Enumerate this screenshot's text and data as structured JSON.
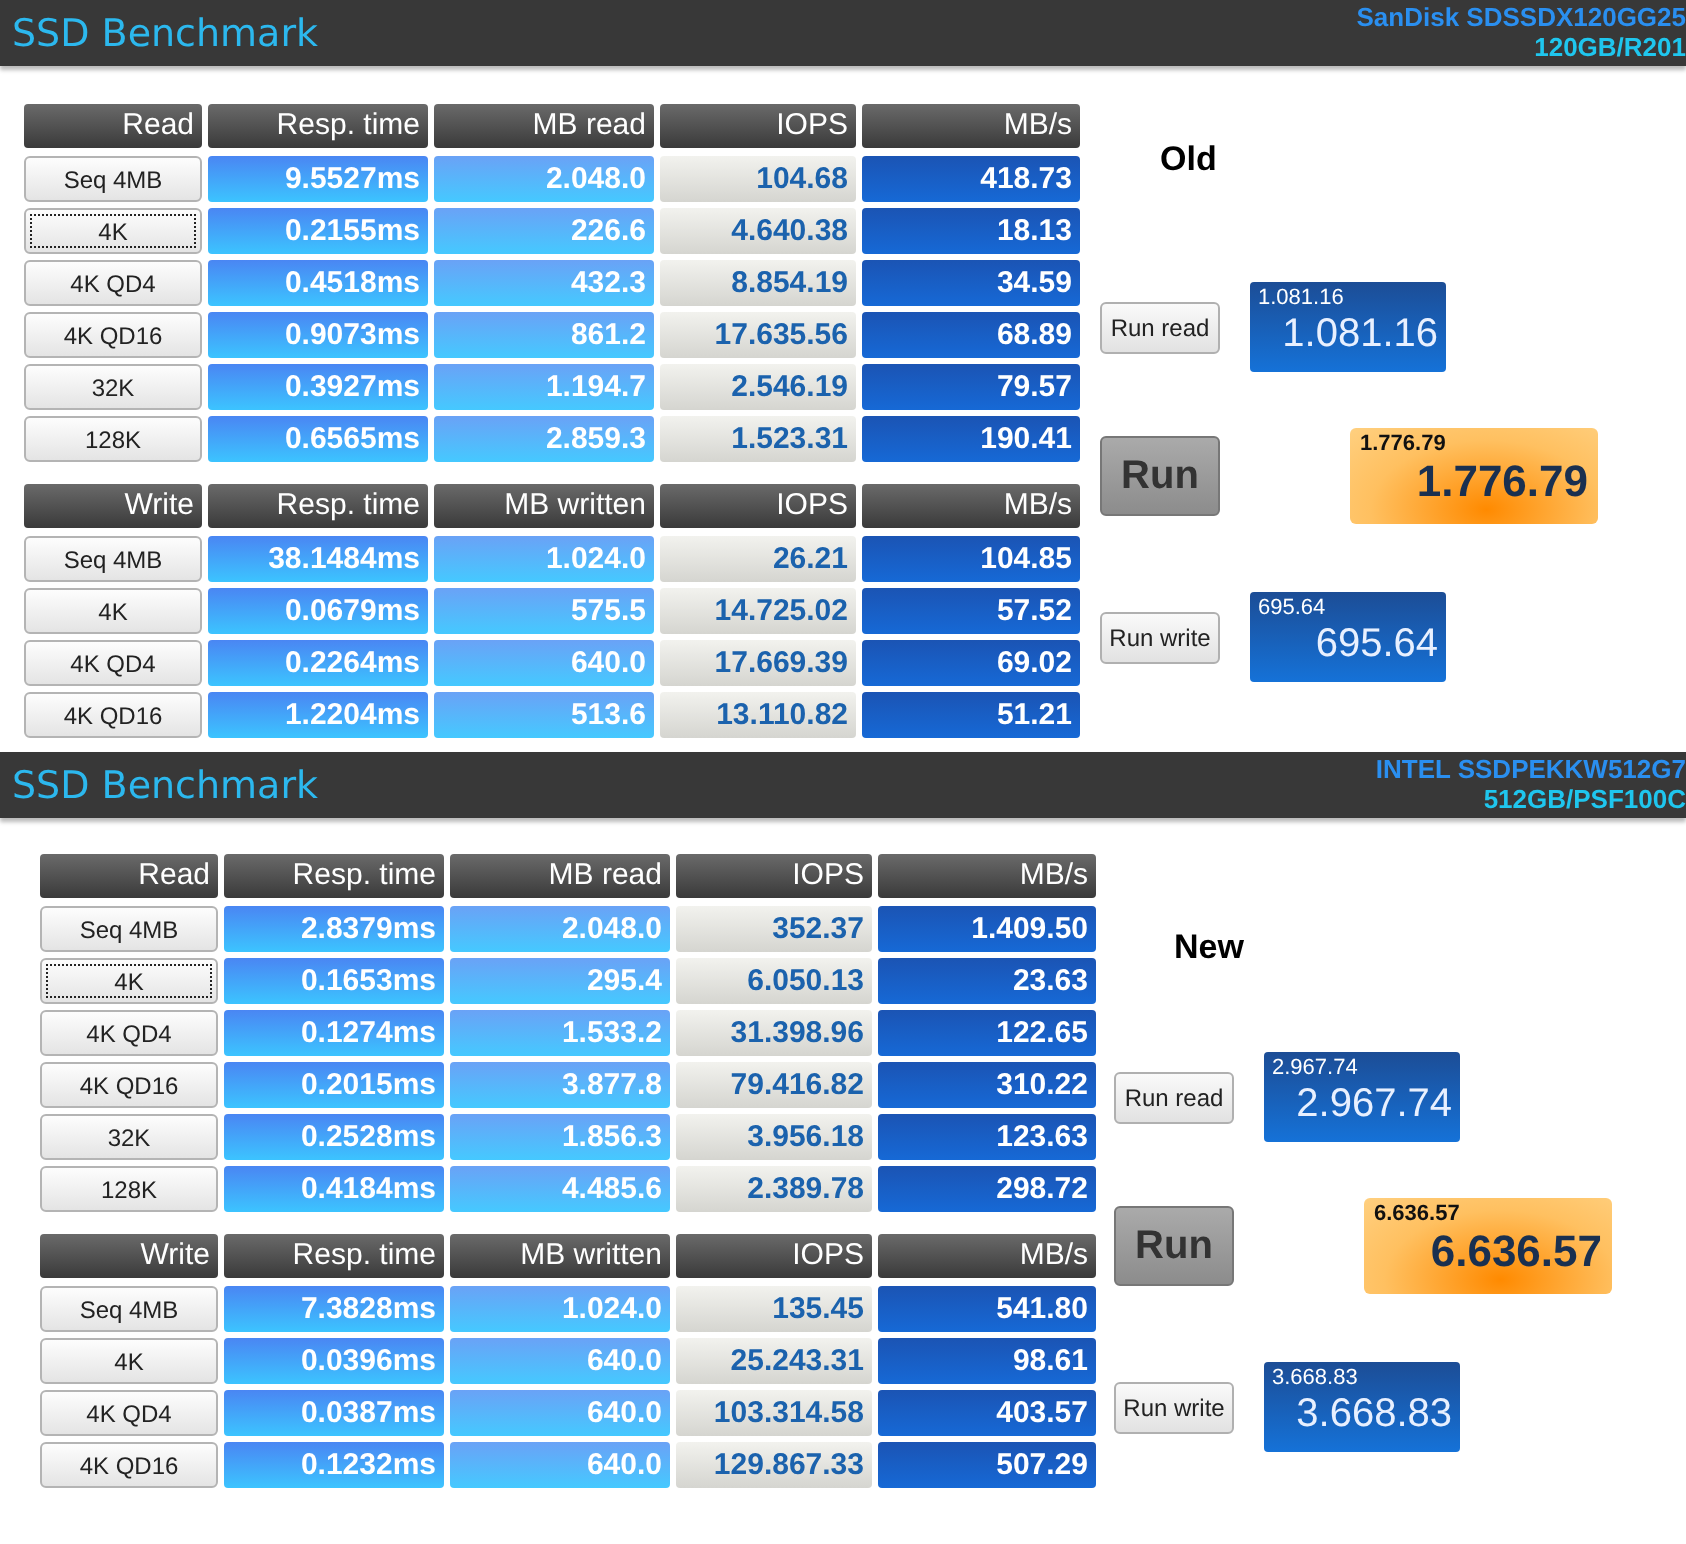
{
  "panels": [
    {
      "title": "SSD Benchmark",
      "drive_model": "SanDisk SDSSDX120GG25",
      "drive_info": "120GB/R201",
      "label": "Old",
      "tables": [
        {
          "columns": [
            "Read",
            "Resp. time",
            "MB read",
            "IOPS",
            "MB/s"
          ],
          "rows": [
            {
              "focused": false,
              "cells": [
                "Seq 4MB",
                "9.5527ms",
                "2.048.0",
                "104.68",
                "418.73"
              ]
            },
            {
              "focused": true,
              "cells": [
                "4K",
                "0.2155ms",
                "226.6",
                "4.640.38",
                "18.13"
              ]
            },
            {
              "focused": false,
              "cells": [
                "4K QD4",
                "0.4518ms",
                "432.3",
                "8.854.19",
                "34.59"
              ]
            },
            {
              "focused": false,
              "cells": [
                "4K QD16",
                "0.9073ms",
                "861.2",
                "17.635.56",
                "68.89"
              ]
            },
            {
              "focused": false,
              "cells": [
                "32K",
                "0.3927ms",
                "1.194.7",
                "2.546.19",
                "79.57"
              ]
            },
            {
              "focused": false,
              "cells": [
                "128K",
                "0.6565ms",
                "2.859.3",
                "1.523.31",
                "190.41"
              ]
            }
          ]
        },
        {
          "columns": [
            "Write",
            "Resp. time",
            "MB written",
            "IOPS",
            "MB/s"
          ],
          "rows": [
            {
              "focused": false,
              "cells": [
                "Seq 4MB",
                "38.1484ms",
                "1.024.0",
                "26.21",
                "104.85"
              ]
            },
            {
              "focused": false,
              "cells": [
                "4K",
                "0.0679ms",
                "575.5",
                "14.725.02",
                "57.52"
              ]
            },
            {
              "focused": false,
              "cells": [
                "4K QD4",
                "0.2264ms",
                "640.0",
                "17.669.39",
                "69.02"
              ]
            },
            {
              "focused": false,
              "cells": [
                "4K QD16",
                "1.2204ms",
                "513.6",
                "13.110.82",
                "51.21"
              ]
            }
          ]
        }
      ],
      "run_read": "Run read",
      "read_score": {
        "caption": "1.081.16",
        "value": "1.081.16"
      },
      "run": "Run",
      "total_score": {
        "caption": "1.776.79",
        "value": "1.776.79"
      },
      "run_write": "Run write",
      "write_score": {
        "caption": "695.64",
        "value": "695.64"
      }
    },
    {
      "title": "SSD Benchmark",
      "drive_model": "INTEL SSDPEKKW512G7",
      "drive_info": "512GB/PSF100C",
      "label": "New",
      "tables": [
        {
          "columns": [
            "Read",
            "Resp. time",
            "MB read",
            "IOPS",
            "MB/s"
          ],
          "rows": [
            {
              "focused": false,
              "cells": [
                "Seq 4MB",
                "2.8379ms",
                "2.048.0",
                "352.37",
                "1.409.50"
              ]
            },
            {
              "focused": true,
              "cells": [
                "4K",
                "0.1653ms",
                "295.4",
                "6.050.13",
                "23.63"
              ]
            },
            {
              "focused": false,
              "cells": [
                "4K QD4",
                "0.1274ms",
                "1.533.2",
                "31.398.96",
                "122.65"
              ]
            },
            {
              "focused": false,
              "cells": [
                "4K QD16",
                "0.2015ms",
                "3.877.8",
                "79.416.82",
                "310.22"
              ]
            },
            {
              "focused": false,
              "cells": [
                "32K",
                "0.2528ms",
                "1.856.3",
                "3.956.18",
                "123.63"
              ]
            },
            {
              "focused": false,
              "cells": [
                "128K",
                "0.4184ms",
                "4.485.6",
                "2.389.78",
                "298.72"
              ]
            }
          ]
        },
        {
          "columns": [
            "Write",
            "Resp. time",
            "MB written",
            "IOPS",
            "MB/s"
          ],
          "rows": [
            {
              "focused": false,
              "cells": [
                "Seq 4MB",
                "7.3828ms",
                "1.024.0",
                "135.45",
                "541.80"
              ]
            },
            {
              "focused": false,
              "cells": [
                "4K",
                "0.0396ms",
                "640.0",
                "25.243.31",
                "98.61"
              ]
            },
            {
              "focused": false,
              "cells": [
                "4K QD4",
                "0.0387ms",
                "640.0",
                "103.314.58",
                "403.57"
              ]
            },
            {
              "focused": false,
              "cells": [
                "4K QD16",
                "0.1232ms",
                "640.0",
                "129.867.33",
                "507.29"
              ]
            }
          ]
        }
      ],
      "run_read": "Run read",
      "read_score": {
        "caption": "2.967.74",
        "value": "2.967.74"
      },
      "run": "Run",
      "total_score": {
        "caption": "6.636.57",
        "value": "6.636.57"
      },
      "run_write": "Run write",
      "write_score": {
        "caption": "3.668.83",
        "value": "3.668.83"
      }
    }
  ]
}
